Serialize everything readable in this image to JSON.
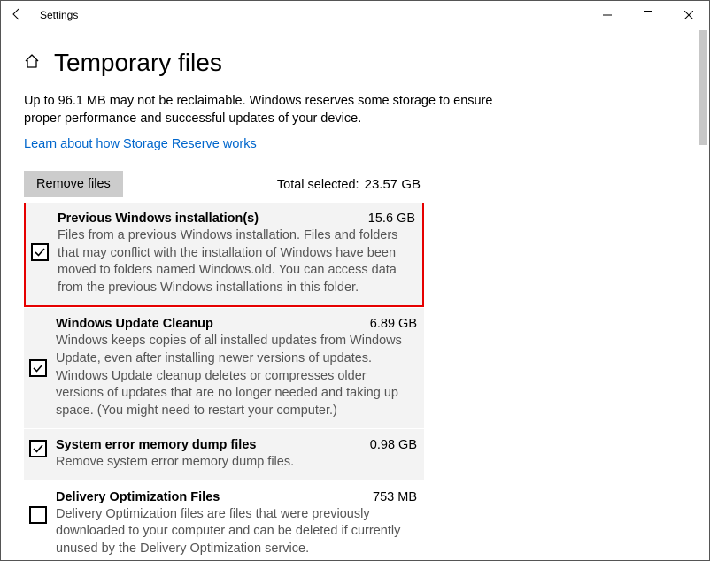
{
  "window": {
    "title": "Settings"
  },
  "page": {
    "title": "Temporary files",
    "intro": "Up to 96.1 MB may not be reclaimable. Windows reserves some storage to ensure proper performance and successful updates of your device.",
    "link": "Learn about how Storage Reserve works",
    "remove_label": "Remove files",
    "total_label": "Total selected:",
    "total_value": "23.57 GB"
  },
  "items": [
    {
      "title": "Previous Windows installation(s)",
      "size": "15.6 GB",
      "desc": "Files from a previous Windows installation.  Files and folders that may conflict with the installation of Windows have been moved to folders named Windows.old.  You can access data from the previous Windows installations in this folder.",
      "checked": true,
      "highlight": true
    },
    {
      "title": "Windows Update Cleanup",
      "size": "6.89 GB",
      "desc": "Windows keeps copies of all installed updates from Windows Update, even after installing newer versions of updates. Windows Update cleanup deletes or compresses older versions of updates that are no longer needed and taking up space. (You might need to restart your computer.)",
      "checked": true,
      "highlight": false
    },
    {
      "title": "System error memory dump files",
      "size": "0.98 GB",
      "desc": "Remove system error memory dump files.",
      "checked": true,
      "highlight": false
    },
    {
      "title": "Delivery Optimization Files",
      "size": "753 MB",
      "desc": "Delivery Optimization files are files that were previously downloaded to your computer and can be deleted if currently unused by the Delivery Optimization service.",
      "checked": false,
      "highlight": false
    }
  ]
}
